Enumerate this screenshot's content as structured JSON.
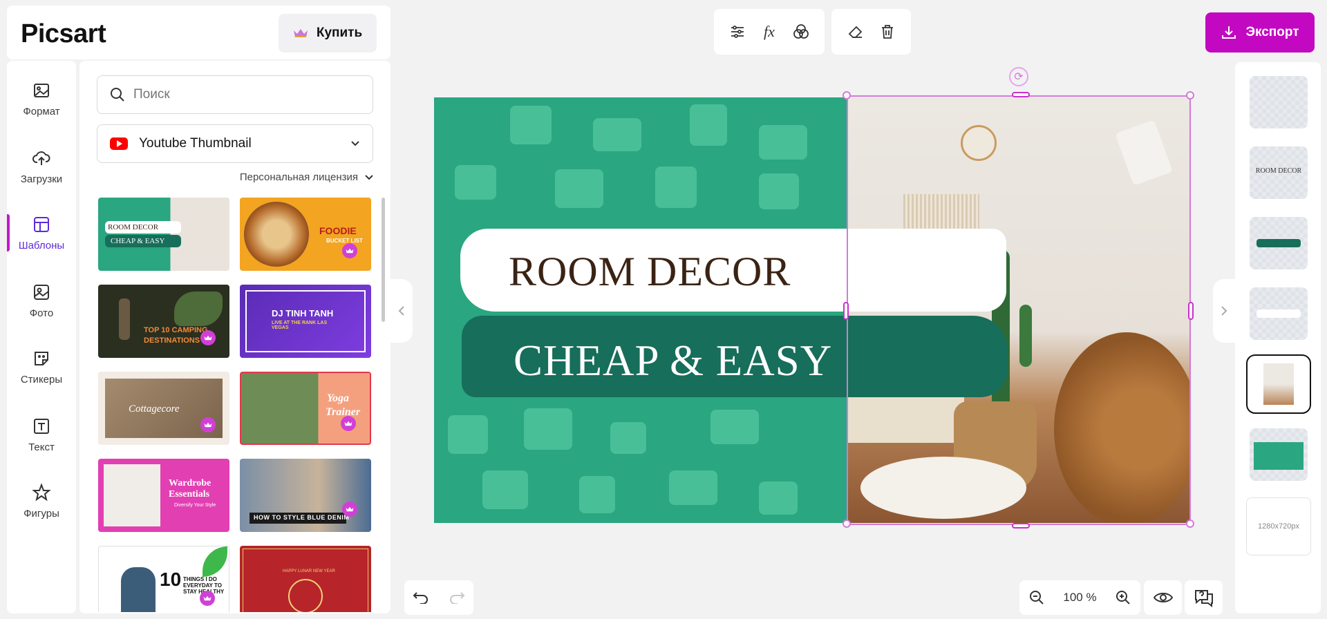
{
  "app": {
    "logo": "Picsart",
    "buy_label": "Купить",
    "export_label": "Экспорт"
  },
  "rail": [
    {
      "label": "Формат",
      "icon": "image-icon"
    },
    {
      "label": "Загрузки",
      "icon": "upload-cloud-icon"
    },
    {
      "label": "Шаблоны",
      "icon": "templates-icon",
      "active": true
    },
    {
      "label": "Фото",
      "icon": "photo-icon"
    },
    {
      "label": "Стикеры",
      "icon": "sticker-icon"
    },
    {
      "label": "Текст",
      "icon": "text-icon"
    },
    {
      "label": "Фигуры",
      "icon": "star-icon"
    }
  ],
  "templates_panel": {
    "search_placeholder": "Поиск",
    "format": "Youtube Thumbnail",
    "license": "Персональная лицензия",
    "items": [
      {
        "line1": "ROOM DECOR",
        "line2": "CHEAP & EASY"
      },
      {
        "line1": "FOODIE",
        "line2": "BUCKET LIST"
      },
      {
        "line1": "TOP 10 CAMPING",
        "line2": "DESTINATIONS"
      },
      {
        "line1": "DJ TINH TANH",
        "line2": "LIVE AT THE RANK LAS VEGAS"
      },
      {
        "line1": "Cottagecore",
        "line2": ""
      },
      {
        "line1": "Yoga",
        "line2": "Trainer"
      },
      {
        "line1": "Wardrobe",
        "line2": "Essentials",
        "line3": "Diversify Your Style"
      },
      {
        "line1": "HOW TO STYLE BLUE DENIM",
        "line2": ""
      },
      {
        "line1": "10",
        "line2": "THINGS I DO EVERYDAY TO STAY HEALTHY"
      },
      {
        "line1": "HAPPY LUNAR NEW YEAR",
        "line2": ""
      }
    ]
  },
  "canvas": {
    "headline": "ROOM DECOR",
    "subline": "CHEAP & EASY",
    "bg_color": "#2aa680",
    "accent_color": "#c209c1"
  },
  "layers": {
    "text_layer_label": "ROOM DECOR",
    "size_label": "1280x720px"
  },
  "zoom": {
    "value": "100 %"
  }
}
